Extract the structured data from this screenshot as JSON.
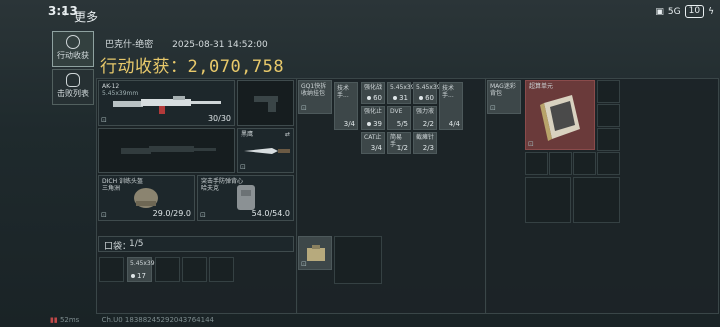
{
  "status_bar": {
    "time": "3:13",
    "signal": "5G",
    "battery": "10"
  },
  "header": {
    "title": "更多"
  },
  "tabs": [
    {
      "label": "行动收获",
      "active": true
    },
    {
      "label": "击败列表",
      "active": false
    }
  ],
  "summary": {
    "map": "巴克什-绝密",
    "datetime": "2025-08-31 14:52:00",
    "income_label": "行动收获：",
    "income_value": "2,070,758"
  },
  "weapons": {
    "primary": {
      "name": "AK-12",
      "caliber": "5.45x39mm",
      "ammo": "30/30"
    },
    "melee": {
      "name": "黑鹰"
    }
  },
  "gear": {
    "helmet": {
      "name": "DICH 训练头盔",
      "sub": "三角洲",
      "durability": "29.0/29.0"
    },
    "armor": {
      "name": "突击手防弹背心",
      "sub": "哈夫克",
      "durability": "54.0/54.0"
    }
  },
  "rig_items": [
    {
      "label": "GQ1快拆",
      "sub": "收纳挂包"
    },
    {
      "label": "技术手...",
      "count": "3/4"
    },
    {
      "label": "强化战",
      "count": "60"
    },
    {
      "label": "5.45x39",
      "count": "31"
    },
    {
      "label": "5.45x39",
      "count": "60"
    },
    {
      "label": "技术手...",
      "count": "4/4"
    },
    {
      "label": "强化止",
      "count": "39"
    },
    {
      "label": "DVE",
      "count": "5/5"
    },
    {
      "label": "强力液",
      "count": "2/2"
    },
    {
      "label": "CAT止",
      "count": "3/4"
    },
    {
      "label": "简易手...",
      "count": "1/2"
    },
    {
      "label": "截瘫针",
      "count": "2/3"
    }
  ],
  "backpack": {
    "label": "MAG迷彩",
    "sub": "背包"
  },
  "case": {
    "label": "超算单元"
  },
  "pocket": {
    "label": "口袋：",
    "count": "1/5",
    "item_label": "5.45x39",
    "item_count": "17"
  },
  "footer": {
    "ping": "52ms",
    "info": "Ch.U0 18388245292043764144"
  },
  "colors": {
    "accent": "#e8c96b",
    "red_item": "#6a3a3a"
  }
}
